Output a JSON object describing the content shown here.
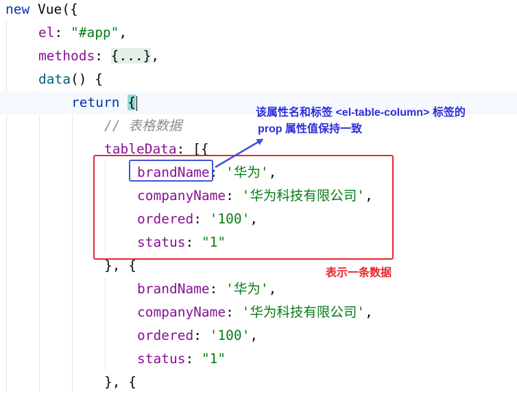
{
  "code": {
    "l1": {
      "kw_new": "new",
      "ctor": "Vue",
      "punct": "({"
    },
    "l2": {
      "key": "el",
      "colon": ": ",
      "value": "\"#app\"",
      "comma": ","
    },
    "l3": {
      "key": "methods",
      "colon": ": ",
      "folded": "{...}",
      "comma": ","
    },
    "l4": {
      "fn": "data",
      "rest": "() {"
    },
    "l5": {
      "kw_return": "return",
      "brace": "{"
    },
    "l6": {
      "comment": "// 表格数据"
    },
    "l7": {
      "key": "tableData",
      "rest": ": [{"
    },
    "rows": [
      {
        "key": "brandName",
        "colon": ": ",
        "value": "'华为'",
        "comma": ","
      },
      {
        "key": "companyName",
        "colon": ": ",
        "value": "'华为科技有限公司'",
        "comma": ","
      },
      {
        "key": "ordered",
        "colon": ": ",
        "value": "'100'",
        "comma": ","
      },
      {
        "key": "status",
        "colon": ": ",
        "value": "\"1\"",
        "comma": ""
      }
    ],
    "separator": "}, {",
    "rows2": [
      {
        "key": "brandName",
        "colon": ": ",
        "value": "'华为'",
        "comma": ","
      },
      {
        "key": "companyName",
        "colon": ": ",
        "value": "'华为科技有限公司'",
        "comma": ","
      },
      {
        "key": "ordered",
        "colon": ": ",
        "value": "'100'",
        "comma": ","
      },
      {
        "key": "status",
        "colon": ": ",
        "value": "\"1\"",
        "comma": ""
      }
    ],
    "separator2": "}, {"
  },
  "annotations": {
    "blue_note_line1": "该属性名和标签 <el-table-column> 标签的",
    "blue_note_line2": "prop 属性值保持一致",
    "red_note": "表示一条数据"
  },
  "colors": {
    "keyword": "#0033b3",
    "string": "#067d17",
    "property": "#871094",
    "function": "#00627a",
    "comment": "#8c8c8c",
    "blue_annotation": "#3f51d6",
    "red_annotation": "#e8242a"
  }
}
